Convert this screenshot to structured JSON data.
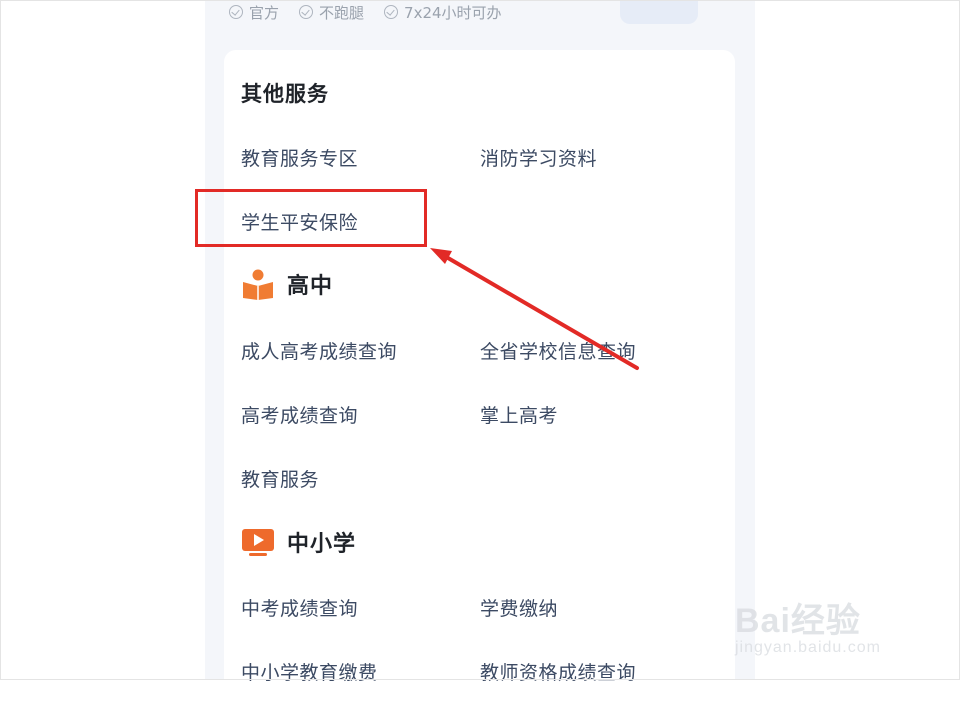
{
  "top_badges": [
    "官方",
    "不跑腿",
    "7x24小时可办"
  ],
  "other_services": {
    "title": "其他服务",
    "items": [
      "教育服务专区",
      "消防学习资料",
      "学生平安保险"
    ]
  },
  "high_school": {
    "title": "高中",
    "icon": "book-reader-icon",
    "icon_color": "#f07c33",
    "items": [
      "成人高考成绩查询",
      "全省学校信息查询",
      "高考成绩查询",
      "掌上高考",
      "教育服务"
    ]
  },
  "primary_middle": {
    "title": "中小学",
    "icon": "video-play-icon",
    "icon_color": "#ee6a2c",
    "items": [
      "中考成绩查询",
      "学费缴纳",
      "中小学教育缴费",
      "教师资格成绩查询"
    ]
  },
  "annotation": {
    "highlight_color": "#e22a26",
    "highlighted_item": "学生平安保险"
  },
  "watermark": {
    "brand": "Bai经验",
    "url": "jingyan.baidu.com"
  }
}
